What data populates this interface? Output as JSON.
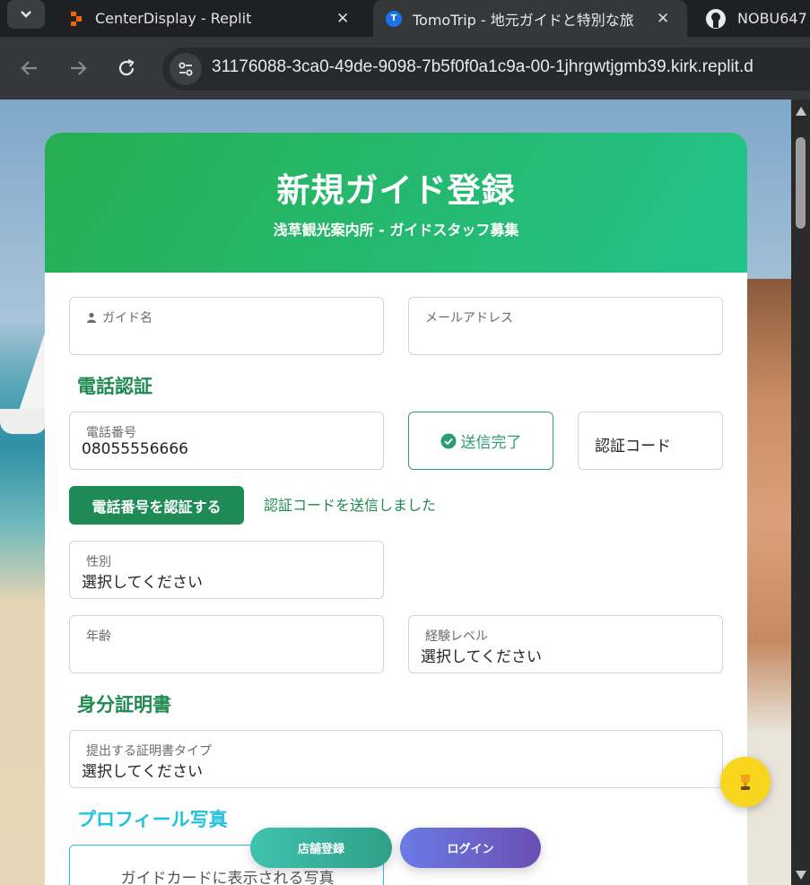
{
  "browser": {
    "tabs": [
      {
        "title": "CenterDisplay - Replit",
        "favicon": "replit-icon",
        "active": false
      },
      {
        "title": "TomoTrip - 地元ガイドと特別な旅",
        "favicon": "tomotrip-icon",
        "active": true
      },
      {
        "title": "NOBU647",
        "favicon": "github-icon",
        "active": false
      }
    ],
    "url": "31176088-3ca0-49de-9098-7b5f0f0a1c9a-00-1jhrgwtjgmb39.kirk.replit.d"
  },
  "form": {
    "title": "新規ガイド登録",
    "subtitle": "浅草観光案内所 - ガイドスタッフ募集",
    "guide_name_label": "ガイド名",
    "email_label": "メールアドレス",
    "phone_section": "電話認証",
    "phone_label": "電話番号",
    "phone_value": "08055556666",
    "sent_button": "送信完了",
    "code_placeholder": "認証コード",
    "verify_button": "電話番号を認証する",
    "code_sent_message": "認証コードを送信しました",
    "gender_label": "性別",
    "gender_value": "選択してください",
    "age_label": "年齢",
    "experience_label": "経験レベル",
    "experience_value": "選択してください",
    "id_section": "身分証明書",
    "id_type_label": "提出する証明書タイプ",
    "id_type_value": "選択してください",
    "photo_section": "プロフィール写真",
    "photo_hint": "ガイドカードに表示される写真"
  },
  "floating": {
    "store_button": "店舗登録",
    "login_button": "ログイン",
    "trophy_icon": "trophy-icon"
  },
  "colors": {
    "header_green": "#27ae52",
    "primary_green": "#1e8a55",
    "cyan": "#1fc3df",
    "trophy_yellow": "#f9d61e"
  }
}
